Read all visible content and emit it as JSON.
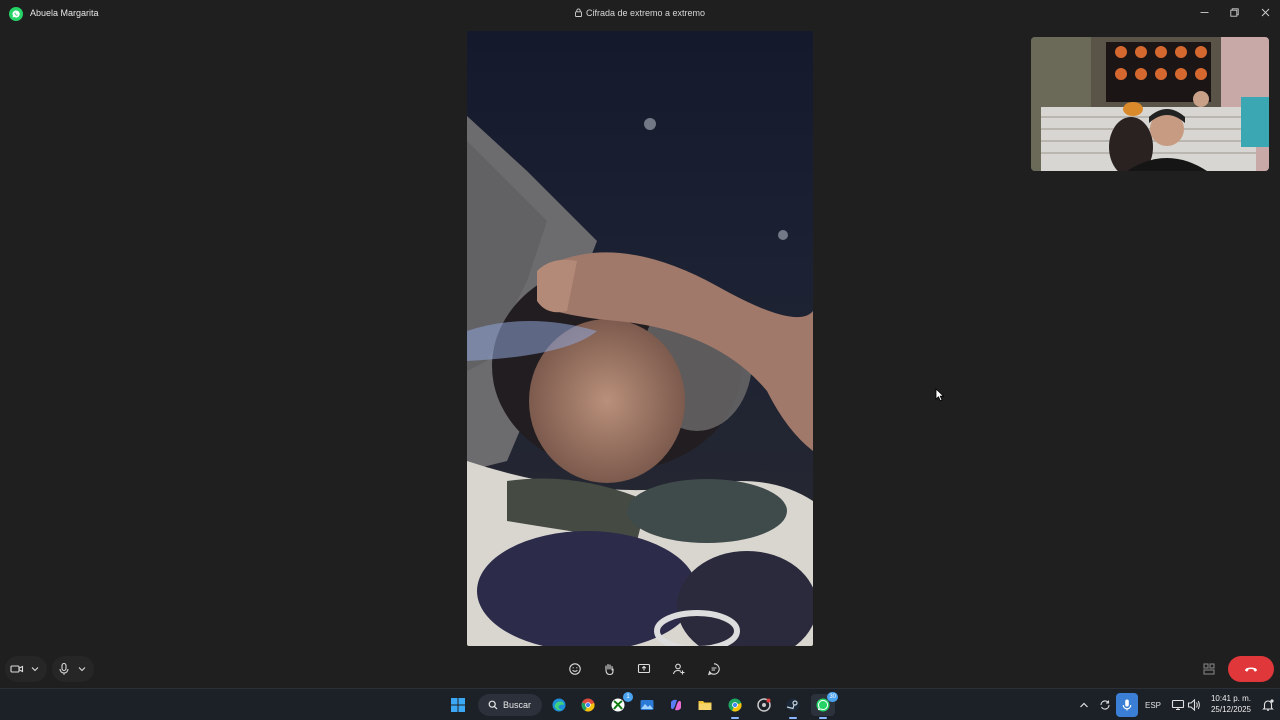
{
  "titlebar": {
    "contact_name": "Abuela Margarita",
    "encryption_text": "Cifrada de extremo a extremo"
  },
  "icons": {
    "app": "whatsapp-icon",
    "lock": "lock-icon",
    "minimize": "minimize-icon",
    "maximize": "maximize-icon",
    "close": "close-icon",
    "camera": "video-camera-icon",
    "mic": "microphone-icon",
    "emoji": "emoji-icon",
    "raise_hand": "raise-hand-icon",
    "share": "share-screen-icon",
    "add_person": "add-person-icon",
    "chat": "chat-icon",
    "layout": "grid-layout-icon",
    "end_call": "end-call-icon"
  },
  "colors": {
    "whatsapp_green": "#25d366",
    "end_call_red": "#e0373b",
    "window_bg": "#1f1f1f",
    "taskbar_bg": "#1c2027"
  },
  "taskbar": {
    "search_label": "Buscar",
    "xbox_badge": "1",
    "whatsapp_badge": "30",
    "language": "ESP",
    "time": "10:41 p. m.",
    "date": "25/12/2025"
  }
}
